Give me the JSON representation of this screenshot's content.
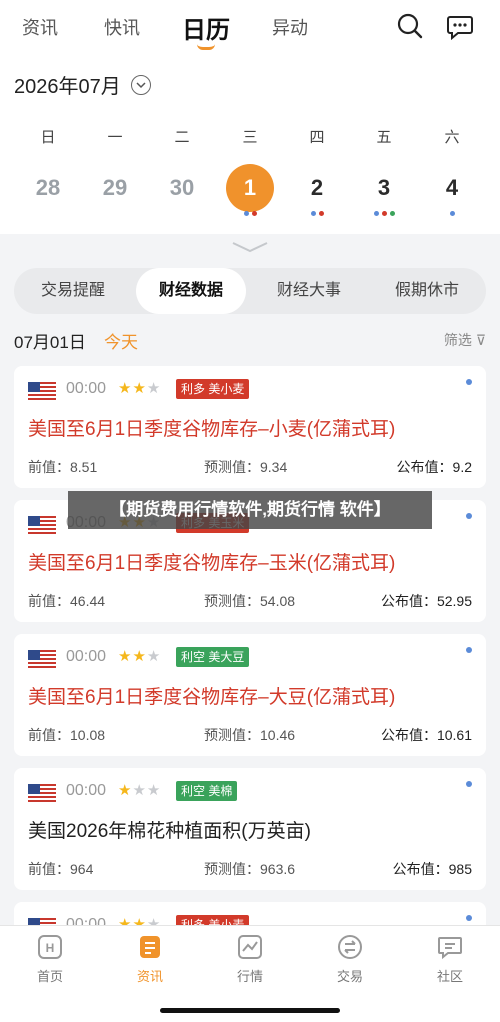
{
  "topnav": {
    "tabs": [
      "资讯",
      "快讯",
      "日历",
      "异动"
    ],
    "active_index": 2
  },
  "calendar": {
    "month_label": "2026年07月",
    "weekdays": [
      "日",
      "一",
      "二",
      "三",
      "四",
      "五",
      "六"
    ],
    "days": [
      "28",
      "29",
      "30",
      "1",
      "2",
      "3",
      "4"
    ],
    "selected_index": 3,
    "day_dots": [
      [],
      [],
      [],
      [
        "#5b8bd8",
        "#d23a2a"
      ],
      [
        "#5b8bd8",
        "#d23a2a"
      ],
      [
        "#5b8bd8",
        "#d23a2a",
        "#3aa35b"
      ],
      [
        "#5b8bd8"
      ]
    ]
  },
  "segments": [
    "交易提醒",
    "财经数据",
    "财经大事",
    "假期休市"
  ],
  "segments_active": 1,
  "date_row": {
    "date": "07月01日",
    "today": "今天",
    "filter": "筛选"
  },
  "cards": [
    {
      "time": "00:00",
      "stars": 2,
      "tag": "利多  美小麦",
      "tag_color": "#d23a2a",
      "title": "美国至6月1日季度谷物库存–小麦(亿蒲式耳)",
      "title_color": "red",
      "prev": "前值：8.51",
      "forecast": "预测值：9.34",
      "actual": "公布值：9.2"
    },
    {
      "time": "00:00",
      "stars": 2,
      "tag": "利多  美玉米",
      "tag_color": "#d23a2a",
      "title": "美国至6月1日季度谷物库存–玉米(亿蒲式耳)",
      "title_color": "red",
      "prev": "前值：46.44",
      "forecast": "预测值：54.08",
      "actual": "公布值：52.95"
    },
    {
      "time": "00:00",
      "stars": 2,
      "tag": "利空  美大豆",
      "tag_color": "#3aa35b",
      "title": "美国至6月1日季度谷物库存–大豆(亿蒲式耳)",
      "title_color": "red",
      "prev": "前值：10.08",
      "forecast": "预测值：10.46",
      "actual": "公布值：10.61"
    },
    {
      "time": "00:00",
      "stars": 1,
      "tag": "利空  美棉",
      "tag_color": "#3aa35b",
      "title": "美国2026年棉花种植面积(万英亩)",
      "title_color": "black",
      "prev": "前值：964",
      "forecast": "预测值：963.6",
      "actual": "公布值：985"
    },
    {
      "time": "00:00",
      "stars": 2,
      "tag": "利多  美小麦",
      "tag_color": "#d23a2a",
      "title": "",
      "title_color": "red",
      "prev": "",
      "forecast": "",
      "actual": ""
    }
  ],
  "overlay_banner": "【期货费用行情软件,期货行情 软件】",
  "bottom_nav": {
    "items": [
      "首页",
      "资讯",
      "行情",
      "交易",
      "社区"
    ],
    "icons": [
      "home-icon",
      "news-icon",
      "chart-icon",
      "trade-icon",
      "community-icon"
    ],
    "active_index": 1
  },
  "colors": {
    "accent": "#f0932b",
    "bullish": "#d23a2a",
    "bearish": "#3aa35b"
  }
}
